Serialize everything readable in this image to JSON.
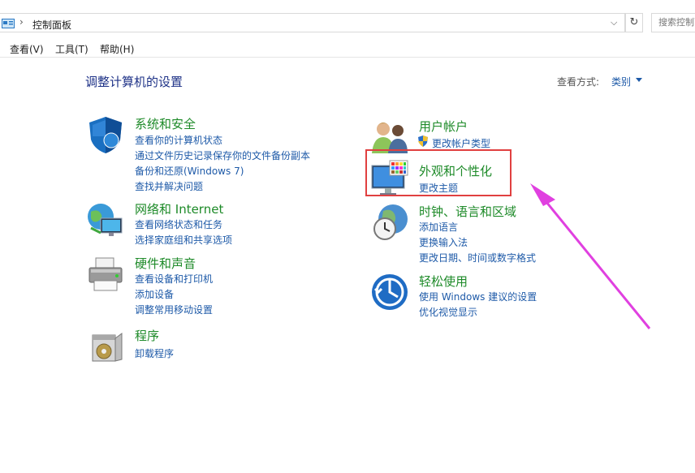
{
  "address": {
    "icon": "control-panel-icon",
    "path": "控制面板",
    "search_placeholder": "搜索控制面板"
  },
  "menu": [
    "查看(V)",
    "工具(T)",
    "帮助(H)"
  ],
  "header": {
    "title": "调整计算机的设置",
    "view_by_label": "查看方式:",
    "view_by_value": "类别"
  },
  "left_categories": [
    {
      "title": "系统和安全",
      "icon": "shield-icon",
      "links": [
        "查看你的计算机状态",
        "通过文件历史记录保存你的文件备份副本",
        "备份和还原(Windows 7)",
        "查找并解决问题"
      ]
    },
    {
      "title": "网络和 Internet",
      "icon": "network-globe-icon",
      "links": [
        "查看网络状态和任务",
        "选择家庭组和共享选项"
      ]
    },
    {
      "title": "硬件和声音",
      "icon": "printer-icon",
      "links": [
        "查看设备和打印机",
        "添加设备",
        "调整常用移动设置"
      ]
    },
    {
      "title": "程序",
      "icon": "programs-box-icon",
      "links": [
        "卸载程序"
      ]
    }
  ],
  "right_categories": [
    {
      "title": "用户帐户",
      "icon": "users-icon",
      "links": [
        "更改帐户类型"
      ]
    },
    {
      "title": "外观和个性化",
      "icon": "monitor-palette-icon",
      "links": [
        "更改主题"
      ]
    },
    {
      "title": "时钟、语言和区域",
      "icon": "clock-globe-icon",
      "links": [
        "添加语言",
        "更换输入法",
        "更改日期、时间或数字格式"
      ]
    },
    {
      "title": "轻松使用",
      "icon": "ease-of-access-icon",
      "links": [
        "使用 Windows 建议的设置",
        "优化视觉显示"
      ]
    }
  ],
  "annotation": {
    "highlight_color": "#e04040",
    "arrow_color": "#e040e0"
  }
}
